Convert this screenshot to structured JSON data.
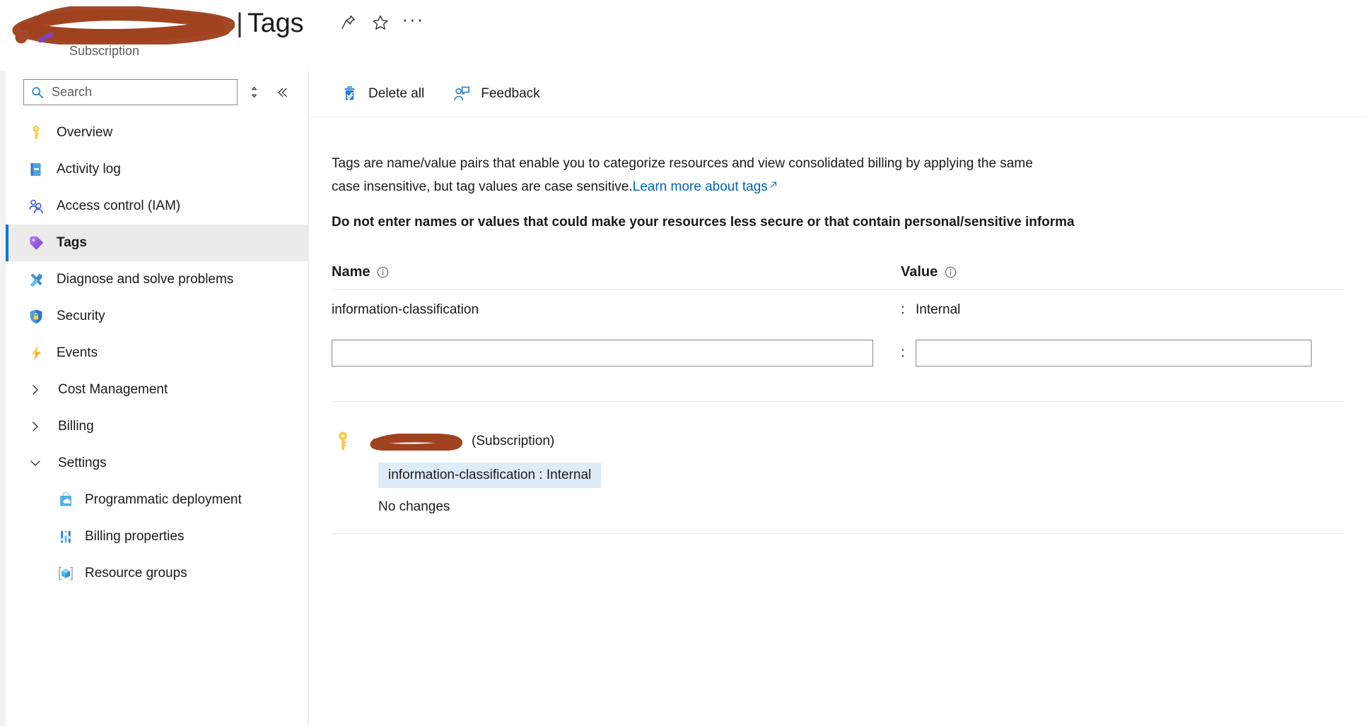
{
  "header": {
    "redacted_name_label": "redacted-subscription-name",
    "separator": "|",
    "title": "Tags",
    "subtitle": "Subscription",
    "actions": [
      {
        "name": "pin-icon",
        "label": "Pin"
      },
      {
        "name": "favorite-icon",
        "label": "Favorite"
      },
      {
        "name": "more-icon",
        "label": "···"
      }
    ]
  },
  "sidebar": {
    "search": {
      "placeholder": "Search",
      "value": ""
    },
    "tools": [
      {
        "name": "resize-handle-icon",
        "label": "Resize"
      },
      {
        "name": "collapse-icon",
        "label": "Collapse"
      }
    ],
    "items": [
      {
        "label": "Overview",
        "icon": "key-icon",
        "selected": false,
        "type": "item"
      },
      {
        "label": "Activity log",
        "icon": "activity-log-icon",
        "selected": false,
        "type": "item"
      },
      {
        "label": "Access control (IAM)",
        "icon": "people-icon",
        "selected": false,
        "type": "item"
      },
      {
        "label": "Tags",
        "icon": "tag-icon",
        "selected": true,
        "type": "item"
      },
      {
        "label": "Diagnose and solve problems",
        "icon": "tools-icon",
        "selected": false,
        "type": "item"
      },
      {
        "label": "Security",
        "icon": "shield-lock-icon",
        "selected": false,
        "type": "item"
      },
      {
        "label": "Events",
        "icon": "lightning-icon",
        "selected": false,
        "type": "item"
      },
      {
        "label": "Cost Management",
        "icon": "chevron-right-icon",
        "selected": false,
        "type": "group",
        "expanded": false
      },
      {
        "label": "Billing",
        "icon": "chevron-right-icon",
        "selected": false,
        "type": "group",
        "expanded": false
      },
      {
        "label": "Settings",
        "icon": "chevron-down-icon",
        "selected": false,
        "type": "group",
        "expanded": true
      },
      {
        "label": "Programmatic deployment",
        "icon": "marketplace-bag-icon",
        "selected": false,
        "type": "child"
      },
      {
        "label": "Billing properties",
        "icon": "sliders-icon",
        "selected": false,
        "type": "child"
      },
      {
        "label": "Resource groups",
        "icon": "resource-group-icon",
        "selected": false,
        "type": "child"
      }
    ]
  },
  "toolbar": {
    "delete_all_label": "Delete all",
    "feedback_label": "Feedback"
  },
  "content": {
    "description_line1": "Tags are name/value pairs that enable you to categorize resources and view consolidated billing by applying the same",
    "description_line2": "case insensitive, but tag values are case sensitive.",
    "learn_more_label": "Learn more about tags",
    "warning": "Do not enter names or values that could make your resources less secure or that contain personal/sensitive informa",
    "table": {
      "headers": {
        "name": "Name",
        "value": "Value"
      },
      "separator": ":",
      "rows": [
        {
          "name": "information-classification",
          "value": "Internal"
        }
      ],
      "new_row": {
        "name": "",
        "value": ""
      }
    },
    "preview": {
      "redacted_name_label": "redacted-subscription-name",
      "scope_label": "(Subscription)",
      "chip": "information-classification : Internal",
      "status": "No changes"
    }
  },
  "colors": {
    "accent": "#0078d4",
    "link": "#0067b8",
    "selected_bg": "#edebe9",
    "chip_bg": "#deecf9",
    "redaction": "#a0411f"
  }
}
